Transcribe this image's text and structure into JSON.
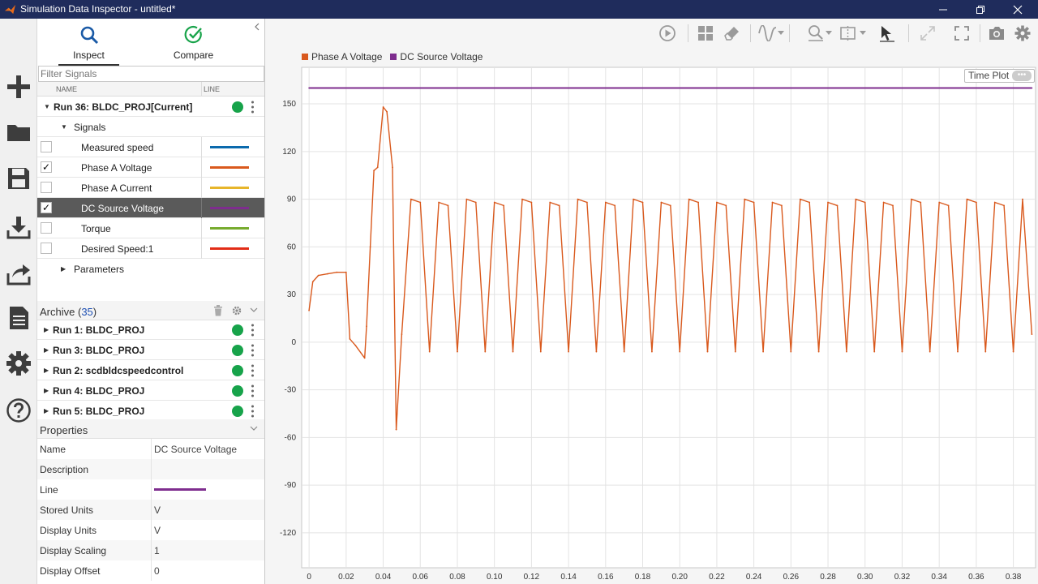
{
  "window": {
    "title": "Simulation Data Inspector - untitled*"
  },
  "tabs": {
    "inspect": "Inspect",
    "compare": "Compare"
  },
  "filter": {
    "placeholder": "Filter Signals"
  },
  "columns": {
    "name": "NAME",
    "line": "LINE"
  },
  "current_run": {
    "label": "Run 36: BLDC_PROJ[Current]"
  },
  "signals_group": "Signals",
  "signals": [
    {
      "name": "Measured speed",
      "checked": false,
      "color": "#0b6aad",
      "selected": false
    },
    {
      "name": "Phase A Voltage",
      "checked": true,
      "color": "#d9591d",
      "selected": false
    },
    {
      "name": "Phase A Current",
      "checked": false,
      "color": "#e7b52a",
      "selected": false
    },
    {
      "name": "DC Source Voltage",
      "checked": true,
      "color": "#7e2d8e",
      "selected": true
    },
    {
      "name": "Torque",
      "checked": false,
      "color": "#77ab2e",
      "selected": false
    },
    {
      "name": "Desired Speed:1",
      "checked": false,
      "color": "#e22d17",
      "selected": false
    }
  ],
  "parameters_group": "Parameters",
  "archive": {
    "label": "Archive",
    "count": "35",
    "runs": [
      "Run 1: BLDC_PROJ",
      "Run 3: BLDC_PROJ",
      "Run 2: scdbldcspeedcontrol",
      "Run 4: BLDC_PROJ",
      "Run 5: BLDC_PROJ"
    ]
  },
  "properties": {
    "label": "Properties",
    "rows": [
      {
        "key": "Name",
        "value": "DC Source Voltage"
      },
      {
        "key": "Description",
        "value": ""
      },
      {
        "key": "Line",
        "value": ""
      },
      {
        "key": "Stored Units",
        "value": "V"
      },
      {
        "key": "Display Units",
        "value": "V"
      },
      {
        "key": "Display Scaling",
        "value": "1"
      },
      {
        "key": "Display Offset",
        "value": "0"
      }
    ],
    "line_color": "#7e2d8e"
  },
  "plot": {
    "badge": "Time Plot",
    "badge_dots": "•••"
  },
  "chart_data": {
    "type": "line",
    "xlabel": "",
    "ylabel": "",
    "xlim": [
      -0.004,
      0.392
    ],
    "ylim": [
      -142,
      173
    ],
    "xticks": [
      0,
      0.02,
      0.04,
      0.06,
      0.08,
      0.1,
      0.12,
      0.14,
      0.16,
      0.18,
      0.2,
      0.22,
      0.24,
      0.26,
      0.28,
      0.3,
      0.32,
      0.34,
      0.36,
      0.38
    ],
    "xtick_labels": [
      "0",
      "0.02",
      "0.04",
      "0.06",
      "0.08",
      "0.10",
      "0.12",
      "0.14",
      "0.16",
      "0.18",
      "0.20",
      "0.22",
      "0.24",
      "0.26",
      "0.28",
      "0.30",
      "0.32",
      "0.34",
      "0.36",
      "0.38"
    ],
    "yticks": [
      -120,
      -90,
      -60,
      -30,
      0,
      30,
      60,
      90,
      120,
      150
    ],
    "ytick_labels": [
      "-120",
      "-90",
      "-60",
      "-30",
      "0",
      "30",
      "60",
      "90",
      "120",
      "150"
    ],
    "grid": true,
    "legend_position": "top-left",
    "series": [
      {
        "name": "Phase A Voltage",
        "color": "#d9591d",
        "x": [
          0,
          0.002,
          0.005,
          0.01,
          0.015,
          0.02,
          0.022,
          0.025,
          0.03,
          0.031,
          0.033,
          0.035,
          0.037,
          0.04,
          0.042,
          0.045,
          0.047,
          0.05,
          0.055,
          0.06,
          0.065,
          0.07,
          0.075,
          0.08,
          0.085,
          0.09,
          0.095,
          0.1,
          0.105,
          0.11,
          0.115,
          0.12,
          0.125,
          0.13,
          0.135,
          0.14,
          0.145,
          0.15,
          0.155,
          0.16,
          0.165,
          0.17,
          0.175,
          0.18,
          0.185,
          0.19,
          0.195,
          0.2,
          0.205,
          0.21,
          0.215,
          0.22,
          0.225,
          0.23,
          0.235,
          0.24,
          0.245,
          0.25,
          0.255,
          0.26,
          0.265,
          0.27,
          0.275,
          0.28,
          0.285,
          0.29,
          0.295,
          0.3,
          0.305,
          0.31,
          0.315,
          0.32,
          0.325,
          0.33,
          0.335,
          0.34,
          0.345,
          0.35,
          0.355,
          0.36,
          0.365,
          0.37,
          0.375,
          0.38,
          0.385,
          0.39
        ],
        "y": [
          20,
          38,
          42,
          43,
          44,
          44,
          2,
          -2,
          -10,
          10,
          60,
          108,
          110,
          148,
          145,
          110,
          -55,
          5,
          90,
          88,
          -6,
          88,
          86,
          -6,
          90,
          88,
          -6,
          88,
          86,
          -6,
          90,
          88,
          -6,
          88,
          86,
          -6,
          90,
          88,
          -6,
          88,
          86,
          -6,
          90,
          88,
          -6,
          88,
          86,
          -6,
          90,
          88,
          -6,
          88,
          86,
          -6,
          90,
          88,
          -6,
          88,
          86,
          -6,
          90,
          88,
          -6,
          88,
          86,
          -6,
          90,
          88,
          -6,
          88,
          86,
          -6,
          90,
          88,
          -6,
          88,
          86,
          -6,
          90,
          88,
          -6,
          88,
          86,
          -6,
          90,
          5
        ]
      },
      {
        "name": "DC Source Voltage",
        "color": "#7e2d8e",
        "x": [
          0,
          0.39
        ],
        "y": [
          160,
          160
        ]
      }
    ]
  }
}
